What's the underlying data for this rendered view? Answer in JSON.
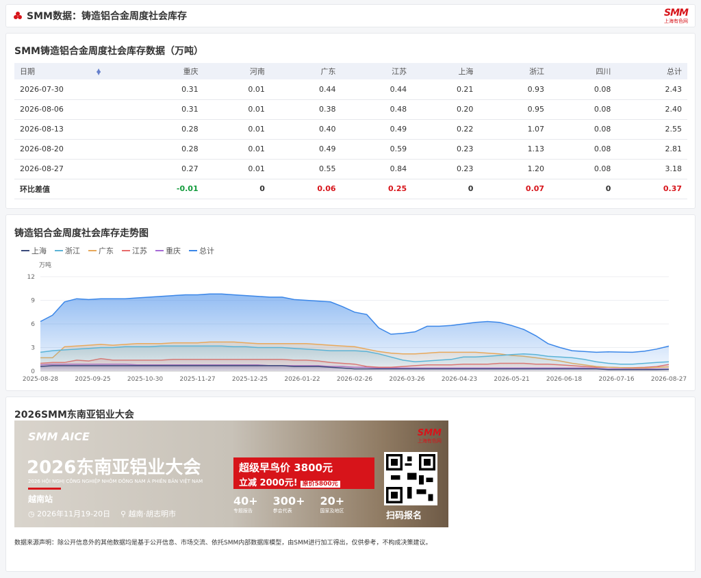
{
  "header": {
    "title": "SMM数据：铸造铝合金周度社会库存",
    "logo_big": "SMM",
    "logo_small": "上海有色网"
  },
  "table": {
    "title": "SMM铸造铝合金周度社会库存数据（万吨）",
    "columns": [
      "日期",
      "重庆",
      "河南",
      "广东",
      "江苏",
      "上海",
      "浙江",
      "四川",
      "总计"
    ],
    "rows": [
      [
        "2026-07-30",
        "0.31",
        "0.01",
        "0.44",
        "0.44",
        "0.21",
        "0.93",
        "0.08",
        "2.43"
      ],
      [
        "2026-08-06",
        "0.31",
        "0.01",
        "0.38",
        "0.48",
        "0.20",
        "0.95",
        "0.08",
        "2.40"
      ],
      [
        "2026-08-13",
        "0.28",
        "0.01",
        "0.40",
        "0.49",
        "0.22",
        "1.07",
        "0.08",
        "2.55"
      ],
      [
        "2026-08-20",
        "0.28",
        "0.01",
        "0.49",
        "0.59",
        "0.23",
        "1.13",
        "0.08",
        "2.81"
      ],
      [
        "2026-08-27",
        "0.27",
        "0.01",
        "0.55",
        "0.84",
        "0.23",
        "1.20",
        "0.08",
        "3.18"
      ]
    ],
    "diff_row": [
      "环比差值",
      "-0.01",
      "0",
      "0.06",
      "0.25",
      "0",
      "0.07",
      "0",
      "0.37"
    ]
  },
  "chart_title": "铸造铝合金周度社会库存走势图",
  "chart_data": {
    "type": "area",
    "ylabel": "万吨",
    "ylim": [
      0,
      12
    ],
    "yticks": [
      0,
      3,
      6,
      9,
      12
    ],
    "xtick_labels": [
      "2025-08-28",
      "2025-09-25",
      "2025-10-30",
      "2025-11-27",
      "2025-12-25",
      "2026-01-22",
      "2026-02-26",
      "2026-03-26",
      "2026-04-23",
      "2026-05-21",
      "2026-06-18",
      "2026-07-16",
      "2026-08-27"
    ],
    "x_start": "2025-08-28",
    "x_end": "2026-08-27",
    "series": [
      {
        "name": "上海",
        "color": "#3a4a7a",
        "values": [
          0.6,
          0.7,
          0.7,
          0.7,
          0.7,
          0.7,
          0.7,
          0.7,
          0.7,
          0.7,
          0.7,
          0.7,
          0.7,
          0.7,
          0.7,
          0.7,
          0.7,
          0.7,
          0.7,
          0.7,
          0.7,
          0.6,
          0.6,
          0.6,
          0.5,
          0.4,
          0.3,
          0.3,
          0.3,
          0.3,
          0.3,
          0.3,
          0.3,
          0.3,
          0.3,
          0.3,
          0.3,
          0.3,
          0.3,
          0.3,
          0.3,
          0.3,
          0.3,
          0.3,
          0.3,
          0.3,
          0.3,
          0.2,
          0.2,
          0.2,
          0.2,
          0.2,
          0.23
        ]
      },
      {
        "name": "浙江",
        "color": "#5bb3d6",
        "values": [
          2.4,
          2.6,
          2.7,
          2.8,
          2.9,
          3.0,
          3.0,
          3.1,
          3.1,
          3.1,
          3.2,
          3.2,
          3.2,
          3.2,
          3.2,
          3.2,
          3.1,
          3.1,
          3.0,
          3.0,
          3.0,
          2.9,
          2.8,
          2.7,
          2.6,
          2.6,
          2.6,
          2.5,
          2.2,
          1.8,
          1.4,
          1.2,
          1.3,
          1.4,
          1.5,
          1.8,
          1.8,
          1.9,
          2.0,
          2.1,
          2.2,
          2.1,
          1.9,
          1.8,
          1.7,
          1.5,
          1.2,
          1.0,
          0.9,
          0.9,
          1.0,
          1.1,
          1.2
        ]
      },
      {
        "name": "广东",
        "color": "#e8a85a",
        "values": [
          1.7,
          1.7,
          3.1,
          3.2,
          3.3,
          3.4,
          3.3,
          3.4,
          3.5,
          3.5,
          3.5,
          3.6,
          3.6,
          3.6,
          3.7,
          3.7,
          3.7,
          3.6,
          3.5,
          3.5,
          3.5,
          3.5,
          3.5,
          3.4,
          3.3,
          3.2,
          3.1,
          2.8,
          2.5,
          2.3,
          2.2,
          2.2,
          2.3,
          2.4,
          2.4,
          2.4,
          2.4,
          2.3,
          2.2,
          2.0,
          1.9,
          1.7,
          1.5,
          1.3,
          1.0,
          0.8,
          0.6,
          0.5,
          0.45,
          0.4,
          0.4,
          0.49,
          0.55
        ]
      },
      {
        "name": "江苏",
        "color": "#e86a6a",
        "values": [
          1.0,
          1.1,
          1.1,
          1.4,
          1.3,
          1.6,
          1.4,
          1.4,
          1.4,
          1.4,
          1.4,
          1.5,
          1.5,
          1.5,
          1.5,
          1.5,
          1.5,
          1.5,
          1.5,
          1.5,
          1.5,
          1.4,
          1.4,
          1.3,
          1.1,
          1.0,
          0.9,
          0.6,
          0.5,
          0.5,
          0.6,
          0.7,
          0.8,
          0.8,
          0.8,
          0.9,
          0.9,
          0.9,
          1.0,
          1.0,
          1.0,
          0.9,
          0.9,
          0.8,
          0.7,
          0.6,
          0.5,
          0.5,
          0.45,
          0.44,
          0.49,
          0.59,
          0.84
        ]
      },
      {
        "name": "重庆",
        "color": "#a66ad6",
        "values": [
          0.8,
          0.9,
          0.9,
          0.9,
          0.9,
          0.9,
          0.9,
          0.9,
          0.8,
          0.8,
          0.8,
          0.8,
          0.8,
          0.8,
          0.8,
          0.8,
          0.8,
          0.8,
          0.8,
          0.7,
          0.7,
          0.7,
          0.7,
          0.7,
          0.6,
          0.6,
          0.5,
          0.5,
          0.4,
          0.4,
          0.4,
          0.4,
          0.4,
          0.4,
          0.4,
          0.4,
          0.4,
          0.4,
          0.4,
          0.4,
          0.4,
          0.4,
          0.4,
          0.4,
          0.4,
          0.4,
          0.35,
          0.3,
          0.3,
          0.31,
          0.28,
          0.28,
          0.27
        ]
      },
      {
        "name": "总计",
        "color": "#3a86e8",
        "values": [
          6.3,
          7.1,
          8.8,
          9.2,
          9.1,
          9.2,
          9.2,
          9.2,
          9.3,
          9.4,
          9.5,
          9.6,
          9.7,
          9.7,
          9.8,
          9.8,
          9.7,
          9.6,
          9.5,
          9.4,
          9.4,
          9.1,
          9.0,
          8.9,
          8.8,
          8.2,
          7.5,
          7.2,
          5.5,
          4.7,
          4.8,
          5.0,
          5.7,
          5.7,
          5.8,
          6.0,
          6.2,
          6.3,
          6.2,
          5.8,
          5.3,
          4.5,
          3.5,
          3.0,
          2.6,
          2.5,
          2.4,
          2.45,
          2.43,
          2.4,
          2.55,
          2.81,
          3.18
        ]
      }
    ]
  },
  "ad": {
    "title": "2026SMM东南亚铝业大会",
    "brand": "SMM AICE",
    "headline": "2026东南亚铝业大会",
    "subline": "2026 HỘI NGHỊ CÔNG NGHIỆP NHÔM ĐÔNG NAM Á PHIÊN BẢN VIỆT NAM",
    "station": "越南站",
    "date": "2026年11月19-20日",
    "place": "越南·胡志明市",
    "early_bird": "超级早鸟价 3800元",
    "discount": "立减 2000元!",
    "original_price": "原价5800元",
    "stats": [
      {
        "n": "40+",
        "t": "专题报告"
      },
      {
        "n": "300+",
        "t": "参会代表"
      },
      {
        "n": "20+",
        "t": "国家及地区"
      }
    ],
    "qr_label": "扫码报名"
  },
  "footnote": "数据来源声明：除公开信息外的其他数据均是基于公开信息、市场交流、依托SMM内部数据库模型，由SMM进行加工得出，仅供参考，不构成决策建议。"
}
